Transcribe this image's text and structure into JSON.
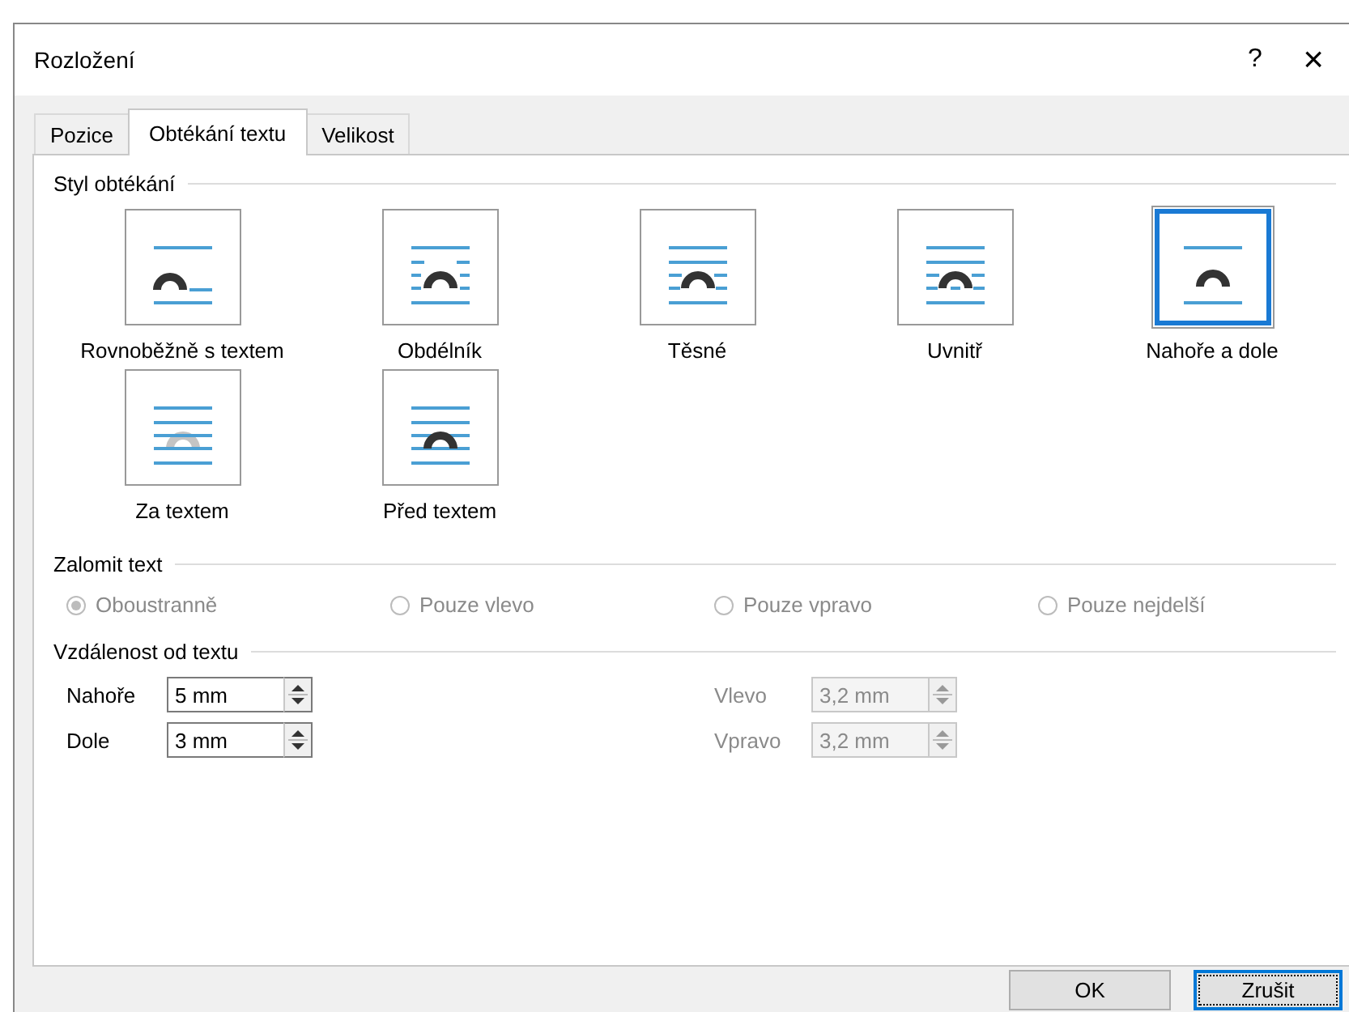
{
  "window": {
    "title": "Rozložení",
    "help": "?",
    "close": "×"
  },
  "tabs": [
    {
      "label": "Pozice",
      "selected": false
    },
    {
      "label": "Obtékání textu",
      "selected": true
    },
    {
      "label": "Velikost",
      "selected": false
    }
  ],
  "wrap_style": {
    "heading": "Styl obtékání",
    "options": [
      {
        "kind": "inline",
        "label": "Rovnoběžně s textem",
        "selected": false
      },
      {
        "kind": "square",
        "label": "Obdélník",
        "selected": false
      },
      {
        "kind": "tight",
        "label": "Těsné",
        "selected": false
      },
      {
        "kind": "through",
        "label": "Uvnitř",
        "selected": false
      },
      {
        "kind": "topbottom",
        "label": "Nahoře a dole",
        "selected": true
      },
      {
        "kind": "behind",
        "label": "Za textem",
        "selected": false
      },
      {
        "kind": "front",
        "label": "Před textem",
        "selected": false
      }
    ]
  },
  "wrap_text": {
    "heading": "Zalomit text",
    "options": [
      {
        "label": "Oboustranně",
        "selected": true,
        "disabled": true
      },
      {
        "label": "Pouze vlevo",
        "selected": false,
        "disabled": true
      },
      {
        "label": "Pouze vpravo",
        "selected": false,
        "disabled": true
      },
      {
        "label": "Pouze nejdelší",
        "selected": false,
        "disabled": true
      }
    ]
  },
  "distance": {
    "heading": "Vzdálenost od textu",
    "fields": [
      {
        "label": "Nahoře",
        "value": "5 mm",
        "disabled": false
      },
      {
        "label": "Vlevo",
        "value": "3,2 mm",
        "disabled": true
      },
      {
        "label": "Dole",
        "value": "3 mm",
        "disabled": false
      },
      {
        "label": "Vpravo",
        "value": "3,2 mm",
        "disabled": true
      }
    ]
  },
  "buttons": [
    {
      "label": "OK",
      "focused": false
    },
    {
      "label": "Zrušit",
      "focused": true
    }
  ]
}
